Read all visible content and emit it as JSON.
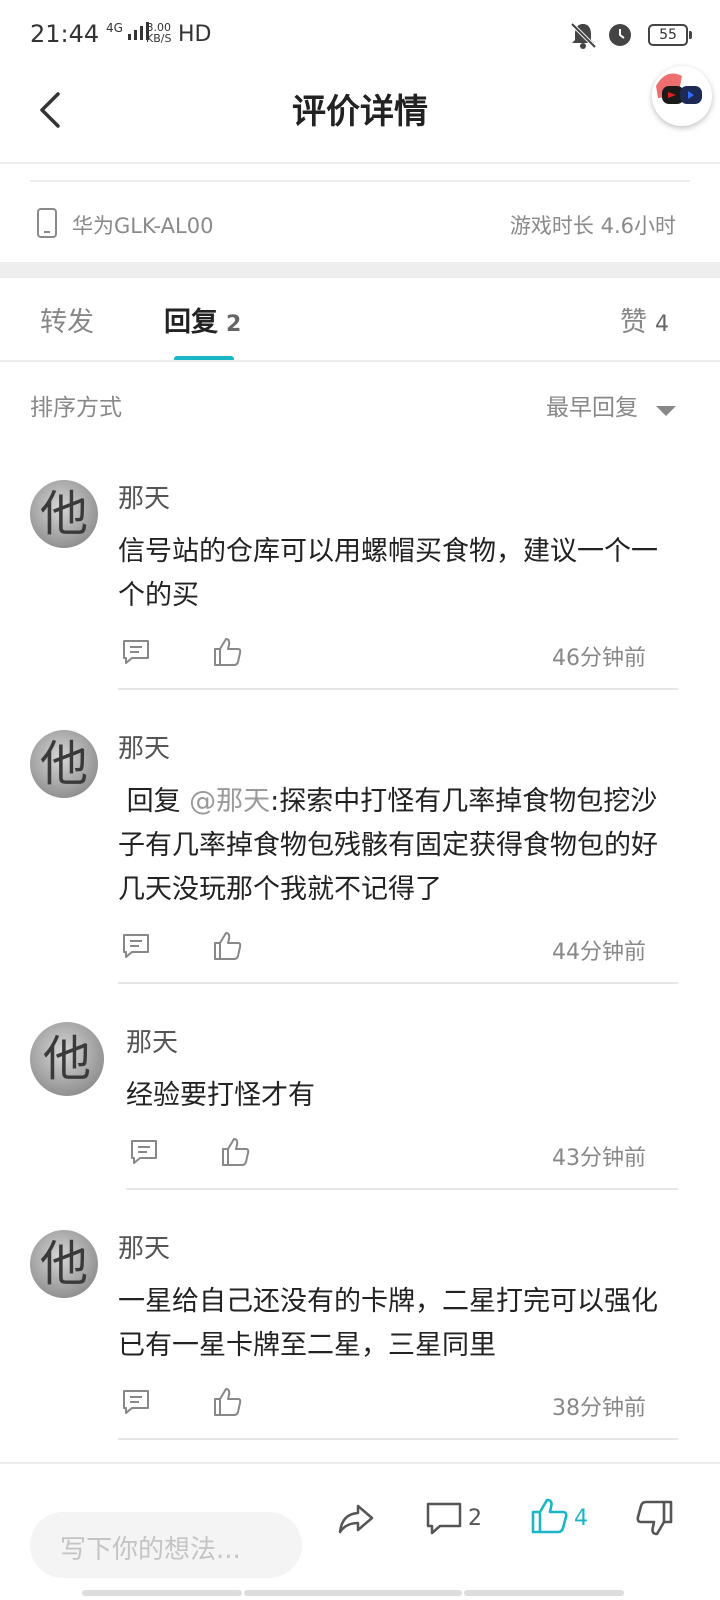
{
  "status_bar": {
    "time": "21:44",
    "network": "4G",
    "speed_value": "3.00",
    "speed_unit": "KB/S",
    "hd": "HD",
    "battery": "55"
  },
  "header": {
    "title": "评价详情"
  },
  "device": {
    "name": "华为GLK-AL00",
    "play_time": "游戏时长 4.6小时"
  },
  "tabs": [
    {
      "label": "转发",
      "count": ""
    },
    {
      "label": "回复",
      "count": "2"
    },
    {
      "label": "赞",
      "count": "4"
    }
  ],
  "sort": {
    "label": "排序方式",
    "value": "最早回复"
  },
  "comments": [
    {
      "user": "那天",
      "avatar_char": "他",
      "text": "信号站的仓库可以用螺帽买食物，建议一个一个的买",
      "mention": "",
      "time": "46分钟前"
    },
    {
      "user": "那天",
      "avatar_char": "他",
      "text_prefix": " 回复 ",
      "mention": "@那天",
      "text": ":探索中打怪有几率掉食物包挖沙子有几率掉食物包残骸有固定获得食物包的好几天没玩那个我就不记得了",
      "time": "44分钟前"
    },
    {
      "user": "那天",
      "avatar_char": "他",
      "text": "经验要打怪才有",
      "mention": "",
      "time": "43分钟前"
    },
    {
      "user": "那天",
      "avatar_char": "他",
      "text": "一星给自己还没有的卡牌，二星打完可以强化已有一星卡牌至二星，三星同里",
      "mention": "",
      "time": "38分钟前"
    }
  ],
  "bottom_bar": {
    "placeholder": "写下你的想法...",
    "comment_count": "2",
    "like_count": "4"
  },
  "colors": {
    "accent": "#1bb6c6",
    "text": "#222222",
    "muted": "#888888"
  }
}
